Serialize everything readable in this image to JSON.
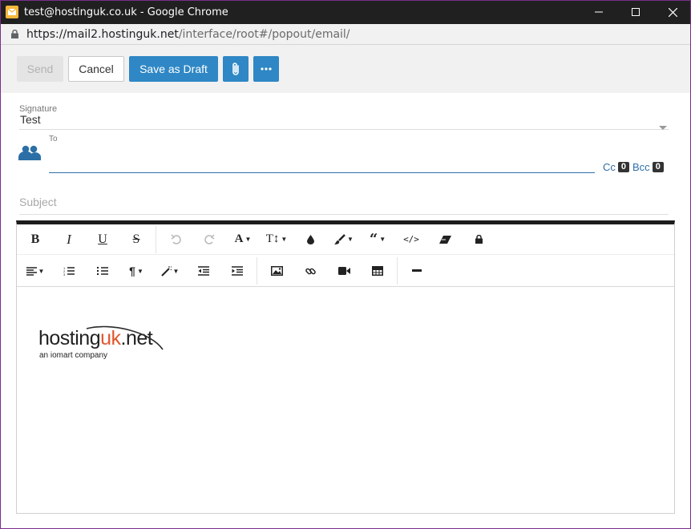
{
  "window": {
    "title": "test@hostinguk.co.uk - Google Chrome",
    "url_host": "https://mail2.hostinguk.net",
    "url_path": "/interface/root#/popout/email/"
  },
  "toolbar": {
    "send_label": "Send",
    "cancel_label": "Cancel",
    "draft_label": "Save as Draft"
  },
  "signature": {
    "label": "Signature",
    "value": "Test"
  },
  "recipients": {
    "to_label": "To",
    "to_value": "",
    "cc_label": "Cc",
    "cc_count": "0",
    "bcc_label": "Bcc",
    "bcc_count": "0"
  },
  "subject": {
    "placeholder": "Subject",
    "value": ""
  },
  "editor_toolbar": {
    "row1": [
      "bold-icon",
      "italic-icon",
      "underline-icon",
      "strikethrough-icon",
      "undo-icon",
      "redo-icon",
      "font-color-icon",
      "font-size-icon",
      "ink-icon",
      "paint-brush-icon",
      "quote-icon",
      "code-icon",
      "eraser-icon",
      "lock-icon"
    ],
    "row2": [
      "align-icon",
      "ordered-list-icon",
      "unordered-list-icon",
      "paragraph-icon",
      "magic-wand-icon",
      "outdent-icon",
      "indent-icon",
      "image-icon",
      "link-icon",
      "video-icon",
      "table-icon",
      "horizontal-rule-icon"
    ]
  },
  "body": {
    "logo_part1": "hosting",
    "logo_part2": "uk",
    "logo_part3": ".net",
    "logo_tagline": "an iomart company"
  },
  "colors": {
    "accent": "#2f87c5",
    "title_bar": "#202020",
    "logo_orange": "#e0572d"
  }
}
